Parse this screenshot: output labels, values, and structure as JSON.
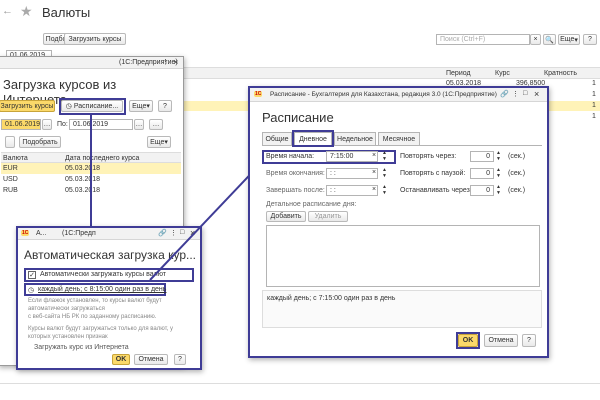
{
  "main": {
    "title": "Валюты",
    "date": "01.06.2019",
    "pick_button": "Подбор",
    "load_rates_button": "Загрузить курсы",
    "search_placeholder": "Поиск (Ctrl+F)",
    "more_button": "Еще",
    "col_period": "Период",
    "col_rate": "Курс",
    "col_mult": "Кратность",
    "row1_period": "05.03.2018",
    "row1_rate": "396,8500",
    "row1_mult": "1",
    "row2_mult": "1",
    "row3_mult": "1",
    "row4_mult": "1"
  },
  "dlg_load": {
    "title_bar": "(1С:Предприятие)",
    "header": "Загрузка курсов из Интернета",
    "load_button": "Загрузить курсы",
    "schedule_button": "Расписание...",
    "more_button": "Еще",
    "help": "?",
    "date_from": "01.06.2019",
    "to_label": "По:",
    "date_to": "01.06.2019",
    "pick_button": "Подобрать",
    "more_button2": "Еще",
    "col_currency": "Валюта",
    "col_last_date": "Дата последнего курса",
    "currencies": [
      {
        "code": "EUR",
        "date": "05.03.2018"
      },
      {
        "code": "USD",
        "date": "05.03.2018"
      },
      {
        "code": "RUB",
        "date": "05.03.2018"
      }
    ]
  },
  "dlg_auto": {
    "title_bar_short": "А...",
    "title_bar": "(1С:Предп",
    "header": "Автоматическая загрузка кур...",
    "checkbox_label": "Автоматически загружать курсы валют",
    "checkbox_checked": true,
    "schedule_link": "каждый день; с 8:15:00 один раз в день",
    "info1": "Если флажок установлен, то курсы валют будут",
    "info2": "автоматически загружаться",
    "info3": "с веб-сайта НБ РК по заданному расписанию.",
    "info4": "Курсы валют будут загружаться только для валют, у",
    "info5": "которых установлен признак",
    "load_internet_label": "Загружать курс из Интернета",
    "ok": "OK",
    "cancel": "Отмена",
    "help": "?"
  },
  "dlg_sched": {
    "title_bar": "Расписание - Бухгалтерия для Казахстана, редакция 3.0 (1С:Предприятие)",
    "header": "Расписание",
    "tabs": [
      "Общие",
      "Дневное",
      "Недельное",
      "Месячное"
    ],
    "start_label": "Время начала:",
    "start_value": "7:15:00",
    "end_label": "Время окончания:",
    "end_value": ": :",
    "finish_label": "Завершать после:",
    "finish_value": ": :",
    "repeat_label": "Повторять через:",
    "pause_label": "Повторять с паузой:",
    "stop_label": "Останавливать через:",
    "zero": "0",
    "sec": "(сек.)",
    "detail_label": "Детальное расписание дня:",
    "add_button": "Добавить",
    "delete_button": "Удалить",
    "summary": "каждый день; с 7:15:00 один раз в день",
    "ok": "OK",
    "cancel": "Отмена",
    "help": "?"
  },
  "colors": {
    "highlight": "#3f3c96",
    "accent": "#fbd96a",
    "selected_row": "#fff3b8"
  }
}
